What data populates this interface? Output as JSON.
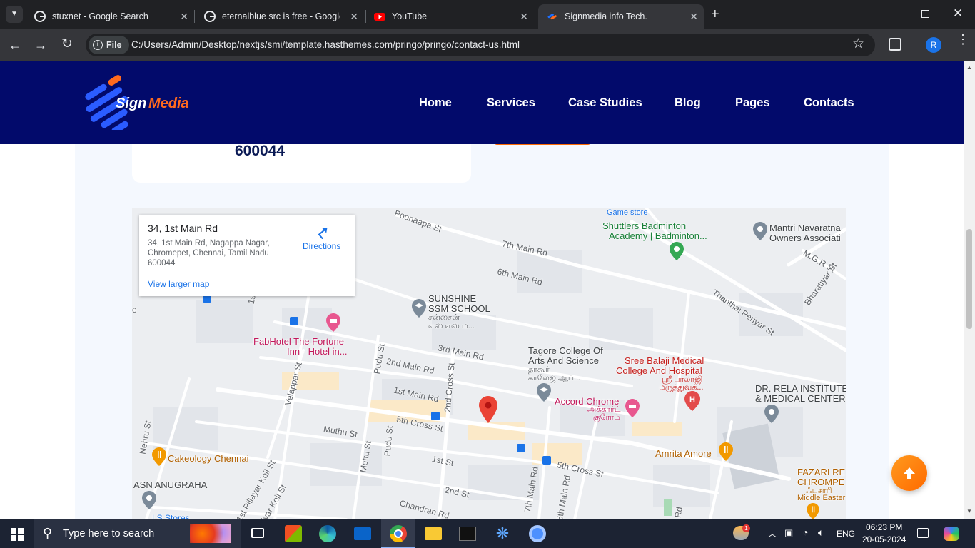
{
  "browser": {
    "tabs": [
      {
        "title": "stuxnet - Google Search",
        "icon": "google-icon"
      },
      {
        "title": "eternalblue src is free - Google",
        "icon": "google-icon"
      },
      {
        "title": "YouTube",
        "icon": "youtube-icon"
      },
      {
        "title": "Signmedia info Tech.",
        "icon": "site-icon",
        "active": true
      }
    ],
    "new_tab": "+",
    "file_chip": "File",
    "url": "C:/Users/Admin/Desktop/nextjs/smi/template.hasthemes.com/pringo/pringo/contact-us.html",
    "profile_initial": "R"
  },
  "site": {
    "logo": {
      "word1": "Sign",
      "word2": "Media"
    },
    "nav": [
      "Home",
      "Services",
      "Case Studies",
      "Blog",
      "Pages",
      "Contacts"
    ],
    "address_pin": "600044"
  },
  "map": {
    "card": {
      "title": "34, 1st Main Rd",
      "address": "34, 1st Main Rd, Nagappa Nagar, Chromepet, Chennai, Tamil Nadu 600044",
      "directions": "Directions",
      "larger_map": "View larger map"
    },
    "labels": {
      "game_store": "Game store",
      "shuttlers1": "Shuttlers Badminton",
      "shuttlers2": "Academy | Badminton...",
      "mantri1": "Mantri Navaratna",
      "mantri2": "Owners Associati",
      "poonaapa": "Poonaapa St",
      "main7": "7th Main Rd",
      "main6": "6th Main Rd",
      "mgr": "M.G.R St",
      "bharatiyar": "Bharatiyar St",
      "thanthai": "Thanthai Periyar St",
      "sunshine1": "SUNSHINE",
      "sunshine2": "SSM SCHOOL",
      "sunshine3": "சன்சைன்",
      "sunshine4": "எஸ் எஸ் ம...",
      "fab1": "FabHotel The Fortune",
      "fab2": "Inn - Hotel in...",
      "main3": "3rd Main Rd",
      "main2": "2nd Main Rd",
      "main1": "1st Main Rd",
      "pudu": "Pudu St",
      "cross2": "2nd Cross St",
      "tagore1": "Tagore College Of",
      "tagore2": "Arts And Science",
      "tagore3": "தாகூர்",
      "tagore4": "காலேஜ் ஆப்...",
      "balaji1": "Sree Balaji Medical",
      "balaji2": "College And Hospital",
      "balaji3": "ஸ்ரீ பாலாஜி",
      "balaji4": "மருத்துவக்...",
      "rela1": "DR. RELA INSTITUTE",
      "rela2": "& MEDICAL CENTER",
      "accord1": "Accord Chrome",
      "accord2": "அக்கார்ட்",
      "accord3": "குரோம்",
      "velappar": "Velappar St",
      "cross5": "5th Cross St",
      "muthu": "Muthu St",
      "pudu2": "Pudu St",
      "nehru": "Nehru St",
      "cakeology": "Cakeology Chennai",
      "mettu": "Mettu St",
      "first": "1st St",
      "cross5b": "5th Cross St",
      "amrita": "Amrita Amore",
      "fazari1": "FAZARI RE",
      "fazari2": "CHROMPE",
      "fazari3": "ஃபசாரி",
      "fazari4": "Middle Easter",
      "asn": "ASN ANUGRAHA",
      "pillayar": "1st Pillayar Koil St",
      "pillayar2": "aiyar Koil St",
      "second": "2nd St",
      "main7b": "7th Main Rd",
      "main6b": "6th Main Rd",
      "chandran": "Chandran Rd",
      "lsstores": "LS Stores",
      "lst": "1st",
      "e": "e",
      "rd": "Rd"
    }
  },
  "taskbar": {
    "search_placeholder": "Type here to search",
    "lang": "ENG",
    "time": "06:23 PM",
    "date": "20-05-2024",
    "weather_badge": "1"
  }
}
